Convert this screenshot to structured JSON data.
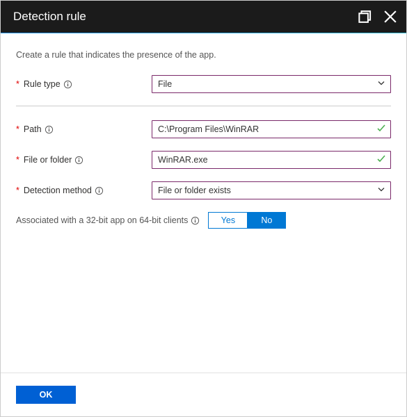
{
  "header": {
    "title": "Detection rule"
  },
  "intro": "Create a rule that indicates the presence of the app.",
  "form": {
    "ruleType": {
      "label": "Rule type",
      "value": "File"
    },
    "path": {
      "label": "Path",
      "value": "C:\\Program Files\\WinRAR"
    },
    "fileOrFolder": {
      "label": "File or folder",
      "value": "WinRAR.exe"
    },
    "detectionMethod": {
      "label": "Detection method",
      "value": "File or folder exists"
    },
    "assoc32": {
      "label": "Associated with a 32-bit app on 64-bit clients",
      "yes": "Yes",
      "no": "No",
      "selected": "no"
    }
  },
  "footer": {
    "ok": "OK"
  },
  "colors": {
    "accentBorder": "#7a2869",
    "primary": "#0078d4"
  }
}
